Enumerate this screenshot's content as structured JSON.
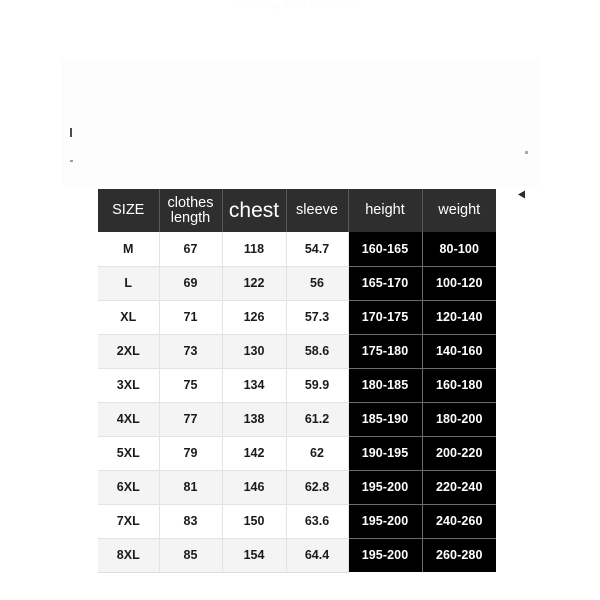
{
  "page": {
    "background_color": "#ffffff",
    "faint_top_text": "clothing size reference"
  },
  "colors": {
    "header_background": "#2e2e2e",
    "header_text": "#ffffff",
    "dark_cell_background": "#000000",
    "dark_cell_text": "#ffffff",
    "row_white": "#ffffff",
    "row_gray": "#f4f4f4",
    "grid_line": "#e3e3e3",
    "body_text": "#1b1b1b"
  },
  "size_chart": {
    "columns": [
      {
        "key": "size",
        "label": "SIZE",
        "label_line1": "SIZE",
        "label_line2": "",
        "emphasis": false,
        "dark": false
      },
      {
        "key": "length",
        "label": "clothes length",
        "label_line1": "clothes",
        "label_line2": "length",
        "emphasis": false,
        "dark": false
      },
      {
        "key": "chest",
        "label": "chest",
        "label_line1": "chest",
        "label_line2": "",
        "emphasis": true,
        "dark": false
      },
      {
        "key": "sleeve",
        "label": "sleeve",
        "label_line1": "sleeve",
        "label_line2": "",
        "emphasis": false,
        "dark": false
      },
      {
        "key": "height",
        "label": "height",
        "label_line1": "height",
        "label_line2": "",
        "emphasis": false,
        "dark": true
      },
      {
        "key": "weight",
        "label": "weight",
        "label_line1": "weight",
        "label_line2": "",
        "emphasis": false,
        "dark": true
      }
    ],
    "rows": [
      {
        "size": "M",
        "length": "67",
        "chest": "118",
        "sleeve": "54.7",
        "height": "160-165",
        "weight": "80-100",
        "shade": "white"
      },
      {
        "size": "L",
        "length": "69",
        "chest": "122",
        "sleeve": "56",
        "height": "165-170",
        "weight": "100-120",
        "shade": "gray"
      },
      {
        "size": "XL",
        "length": "71",
        "chest": "126",
        "sleeve": "57.3",
        "height": "170-175",
        "weight": "120-140",
        "shade": "white"
      },
      {
        "size": "2XL",
        "length": "73",
        "chest": "130",
        "sleeve": "58.6",
        "height": "175-180",
        "weight": "140-160",
        "shade": "gray"
      },
      {
        "size": "3XL",
        "length": "75",
        "chest": "134",
        "sleeve": "59.9",
        "height": "180-185",
        "weight": "160-180",
        "shade": "white"
      },
      {
        "size": "4XL",
        "length": "77",
        "chest": "138",
        "sleeve": "61.2",
        "height": "185-190",
        "weight": "180-200",
        "shade": "gray"
      },
      {
        "size": "5XL",
        "length": "79",
        "chest": "142",
        "sleeve": "62",
        "height": "190-195",
        "weight": "200-220",
        "shade": "white"
      },
      {
        "size": "6XL",
        "length": "81",
        "chest": "146",
        "sleeve": "62.8",
        "height": "195-200",
        "weight": "220-240",
        "shade": "gray"
      },
      {
        "size": "7XL",
        "length": "83",
        "chest": "150",
        "sleeve": "63.6",
        "height": "195-200",
        "weight": "240-260",
        "shade": "white"
      },
      {
        "size": "8XL",
        "length": "85",
        "chest": "154",
        "sleeve": "64.4",
        "height": "195-200",
        "weight": "260-280",
        "shade": "gray"
      }
    ]
  }
}
